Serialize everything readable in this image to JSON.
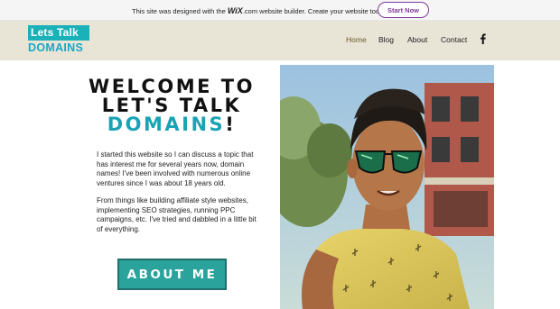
{
  "banner": {
    "text_pre": "This site was designed with the ",
    "brand": "WiX",
    "text_post": ".com website builder. Create your website today.",
    "cta": "Start Now"
  },
  "logo": {
    "line1": "Lets Talk",
    "line2": "DOMAINS"
  },
  "nav": {
    "items": [
      "Home",
      "Blog",
      "About",
      "Contact"
    ],
    "active": "Home",
    "social_icon": "facebook-icon"
  },
  "hero": {
    "line1": "WELCOME TO",
    "line2": "LET'S TALK",
    "line3_highlight": "DOMAINS",
    "line3_end": "!"
  },
  "body": {
    "paragraph1": "I started this website so I can discuss a topic that has interest me for several years now, domain names! I've been involved with numerous online ventures since I was about 18 years old.",
    "paragraph2": "From things like building affiliate style websites, implementing SEO strategies, running PPC campaigns, etc. I've tried and dabbled in a little bit of everything."
  },
  "about_button": "ABOUT ME",
  "colors": {
    "accent": "#1aa3b5",
    "header_bg": "#e8e4d6",
    "button_bg": "#2aa39c",
    "cta_border": "#7e3a96"
  }
}
